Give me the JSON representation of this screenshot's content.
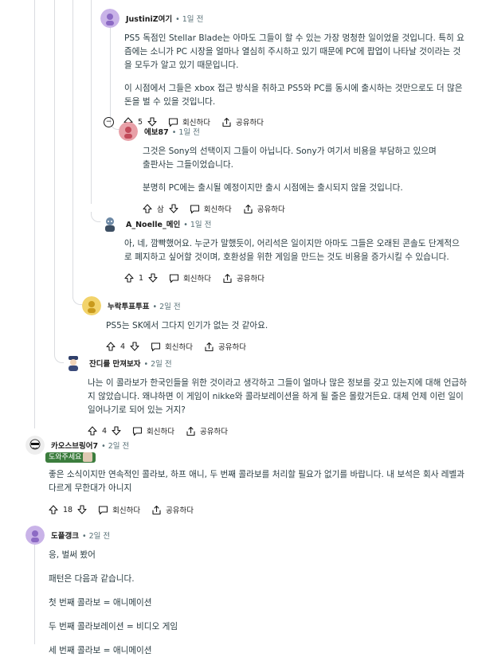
{
  "actions": {
    "reply": "회신하다",
    "share": "공유하다"
  },
  "comments": [
    {
      "user": "JustiniZ여기",
      "time": "1일 전",
      "paragraphs": [
        "PS5 독점인 Stellar Blade는 아마도 그들이 할 수 있는 가장 멍청한 일이었을 것입니다. 특히 요즘에는 소니가 PC 시장을 얼마나 열심히 주시하고 있기 때문에 PC에 팝업이 나타날 것이라는 것을 모두가 알고 있기 때문입니다.",
        "이 시점에서 그들은 xbox 접근 방식을 취하고 PS5와 PC를 동시에 출시하는 것만으로도 더 많은 돈을 벌 수 있을 것입니다."
      ],
      "votes": "5",
      "collapse": "−",
      "avatar_color": "#c9b3e8"
    },
    {
      "user": "에보87",
      "time": "1일 전",
      "paragraphs": [
        "그것은 Sony의 선택이지 그들이 아닙니다. Sony가 여기서 비용을 부담하고 있으며 출판사는 그들이었습니다.",
        "분명히 PC에는 출시될 예정이지만 출시 시점에는 출시되지 않을 것입니다."
      ],
      "votes": "삼",
      "avatar_color": "#e8a0a8"
    },
    {
      "user": "A_Noelle_메인",
      "time": "1일 전",
      "paragraphs": [
        "아, 네, 깜빡했어요. 누군가 말했듯이, 어리석은 일이지만 아마도 그들은 오래된 콘솔도 단계적으로 폐지하고 싶어할 것이며, 호환성을 위한 게임을 만드는 것도 비용을 증가시킬 수 있습니다."
      ],
      "votes": "1",
      "avatar_color": "#b8c8d8"
    },
    {
      "user": "누락투표투표",
      "time": "2일 전",
      "paragraphs": [
        "PS5는 SK에서 그다지 인기가 없는 것 같아요."
      ],
      "votes": "4",
      "avatar_color": "#f2d36b"
    },
    {
      "user": "잔디를 만져보자",
      "time": "2일 전",
      "paragraphs": [
        "나는 이 콜라보가 한국인들을 위한 것이라고 생각하고 그들이 얼마나 많은 정보를 갖고 있는지에 대해 언급하지 않았습니다. 왜냐하면 이 게임이 nikke와 콜라보레이션을 하게 될 줄은 몰랐거든요. 대체 언제 이런 일이 일어나기로 되어 있는 거지?"
      ],
      "votes": "4",
      "avatar_color": "#d6dde6"
    },
    {
      "user": "카오스브링어7",
      "time": "2일 전",
      "flair": "도와주세요",
      "paragraphs": [
        "좋은 소식이지만 연속적인 콜라보, 하프 애니, 두 번째 콜라보를 처리할 필요가 없기를 바랍니다. 내 보석은 회사 레벨과 다르게 무한대가 아니지"
      ],
      "votes": "18",
      "avatar_color": "#eeeeee"
    },
    {
      "user": "도플갱크",
      "time": "2일 전",
      "paragraphs": [
        "응, 벌써 봤어",
        "패턴은 다음과 같습니다.",
        "첫 번째 콜라보 = 애니메이션",
        "두 번째 콜라보레이션 = 비디오 게임",
        "세 번째 콜라보 = 애니메이션"
      ],
      "avatar_color": "#c9b3e8"
    }
  ]
}
